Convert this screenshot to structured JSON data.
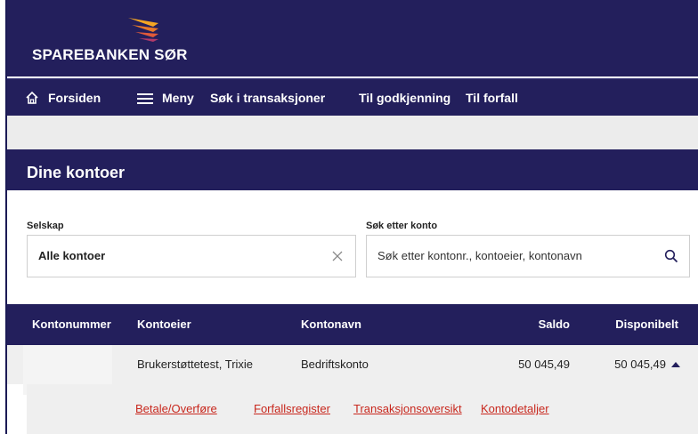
{
  "brand": {
    "name": "SPAREBANKEN SØR"
  },
  "nav": {
    "home": "Forsiden",
    "menu": "Meny",
    "search_tx": "Søk i transaksjoner",
    "approval": "Til godkjenning",
    "due": "Til forfall"
  },
  "section": {
    "title": "Dine kontoer"
  },
  "filters": {
    "company_label": "Selskap",
    "company_value": "Alle kontoer",
    "search_label": "Søk etter konto",
    "search_placeholder": "Søk etter kontonr., kontoeier, kontonavn"
  },
  "table": {
    "columns": [
      "Kontonummer",
      "Kontoeier",
      "Kontonavn",
      "Saldo",
      "Disponibelt"
    ],
    "rows": [
      {
        "number": "",
        "owner": "Brukerstøttetest, Trixie",
        "name": "Bedriftskonto",
        "balance": "50 045,49",
        "available": "50 045,49"
      }
    ]
  },
  "actions": [
    "Betale/Overføre",
    "Forfallsregister",
    "Transaksjonsoversikt",
    "Kontodetaljer"
  ],
  "colors": {
    "brand": "#231f5c",
    "link": "#c8281e",
    "logo_orange": "#f5a623"
  }
}
